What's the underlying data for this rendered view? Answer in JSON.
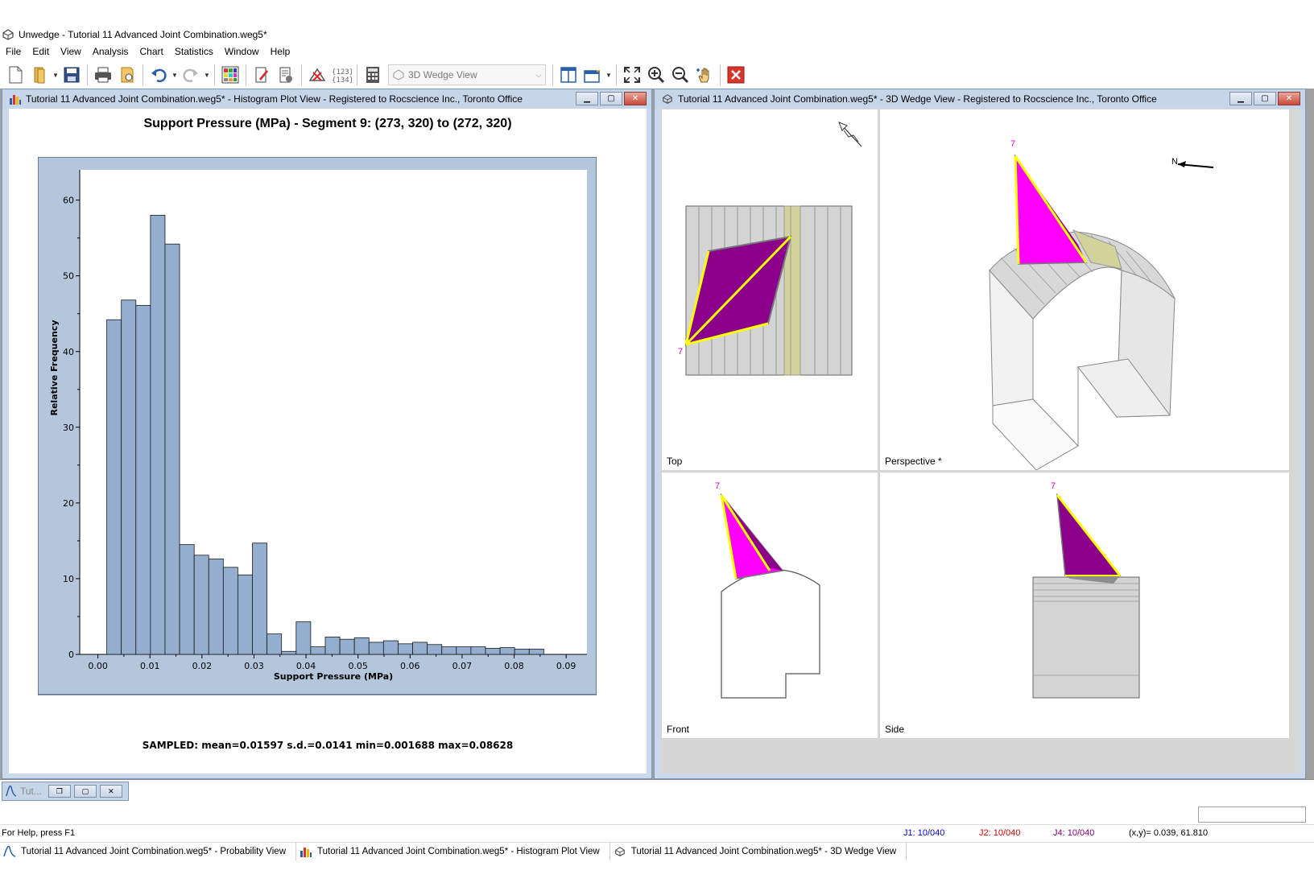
{
  "app": {
    "title": "Unwedge - Tutorial 11 Advanced Joint Combination.weg5*"
  },
  "menu": [
    "File",
    "Edit",
    "View",
    "Analysis",
    "Chart",
    "Statistics",
    "Window",
    "Help"
  ],
  "toolbar": {
    "view_select_value": "3D Wedge View"
  },
  "windows": {
    "histogram": {
      "title": "Tutorial 11 Advanced Joint Combination.weg5* - Histogram Plot View - Registered to Rocscience Inc., Toronto Office"
    },
    "wedge3d": {
      "title": "Tutorial 11 Advanced Joint Combination.weg5* - 3D Wedge View - Registered to Rocscience Inc., Toronto Office",
      "panes": {
        "top": "Top",
        "perspective": "Perspective *",
        "front": "Front",
        "side": "Side"
      },
      "wedge_label": "7",
      "north_label": "N",
      "colors": {
        "wedge_fill": "#ff00ff",
        "wedge_dark": "#8b008b",
        "wedge_edge": "#ffff00",
        "wedge_label": "#cc00cc",
        "tunnel_fill": "#d4d4d4"
      }
    },
    "minimized": {
      "label": "Tut..."
    }
  },
  "chart_data": {
    "type": "bar",
    "title": "Support Pressure (MPa) - Segment 9: (273, 320) to (272, 320)",
    "xlabel": "Support Pressure (MPa)",
    "ylabel": "Relative Frequency",
    "xlim": [
      -0.0035,
      0.094
    ],
    "ylim": [
      0,
      64
    ],
    "xticks": [
      "0.00",
      "0.01",
      "0.02",
      "0.03",
      "0.04",
      "0.05",
      "0.06",
      "0.07",
      "0.08",
      "0.09"
    ],
    "xtick_values": [
      0,
      0.01,
      0.02,
      0.03,
      0.04,
      0.05,
      0.06,
      0.07,
      0.08,
      0.09
    ],
    "yticks": [
      "0",
      "10",
      "20",
      "30",
      "40",
      "50",
      "60"
    ],
    "ytick_values": [
      0,
      10,
      20,
      30,
      40,
      50,
      60
    ],
    "bin_start": 0.0017,
    "bin_width": 0.0028,
    "values": [
      44.2,
      46.8,
      46.1,
      58.0,
      54.2,
      14.5,
      13.1,
      12.6,
      11.5,
      10.5,
      14.7,
      2.7,
      0.4,
      4.3,
      1.0,
      2.3,
      2.0,
      2.2,
      1.6,
      1.8,
      1.4,
      1.6,
      1.3,
      1.0,
      1.0,
      1.0,
      0.8,
      0.9,
      0.7,
      0.7
    ],
    "bar_color": "#94aed0",
    "summary": "SAMPLED: mean=0.01597 s.d.=0.0141 min=0.001688 max=0.08628",
    "grid": false,
    "legend": "none"
  },
  "status": {
    "help": "For Help, press F1",
    "j1": "J1: 10/040",
    "j2": "J2: 10/040",
    "j4": "J4: 10/040",
    "coords": "(x,y)= 0.039, 61.810"
  },
  "window_tabs": [
    "Tutorial 11 Advanced Joint Combination.weg5* - Probability View",
    "Tutorial 11 Advanced Joint Combination.weg5* - Histogram Plot View",
    "Tutorial 11 Advanced Joint Combination.weg5* - 3D Wedge View"
  ]
}
